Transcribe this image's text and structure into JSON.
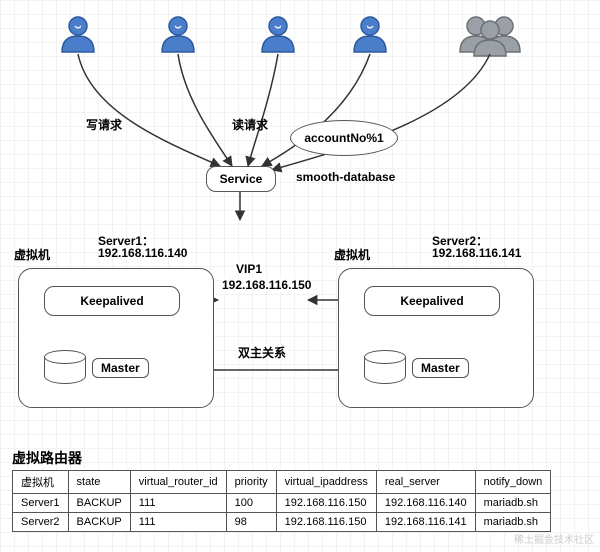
{
  "clients": {
    "count_blue": 4,
    "count_gray_group": 1
  },
  "request_labels": {
    "write": "写请求",
    "read": "读请求"
  },
  "service": {
    "label": "Service",
    "partition_bubble": "accountNo%1",
    "db_label": "smooth-database"
  },
  "vip": {
    "name": "VIP1",
    "ip": "192.168.116.150"
  },
  "relation_label": "双主关系",
  "servers": [
    {
      "vm_label": "虚拟机",
      "title": "Server1：",
      "ip": "192.168.116.140",
      "keepalived": "Keepalived",
      "master": "Master"
    },
    {
      "vm_label": "虚拟机",
      "title": "Server2：",
      "ip": "192.168.116.141",
      "keepalived": "Keepalived",
      "master": "Master"
    }
  ],
  "vrouter": {
    "title": "虚拟路由器",
    "columns": [
      "虚拟机",
      "state",
      "virtual_router_id",
      "priority",
      "virtual_ipaddress",
      "real_server",
      "notify_down"
    ],
    "rows": [
      [
        "Server1",
        "BACKUP",
        "111",
        "100",
        "192.168.116.150",
        "192.168.116.140",
        "mariadb.sh"
      ],
      [
        "Server2",
        "BACKUP",
        "111",
        "98",
        "192.168.116.150",
        "192.168.116.141",
        "mariadb.sh"
      ]
    ]
  },
  "watermark": "稀土掘金技术社区"
}
